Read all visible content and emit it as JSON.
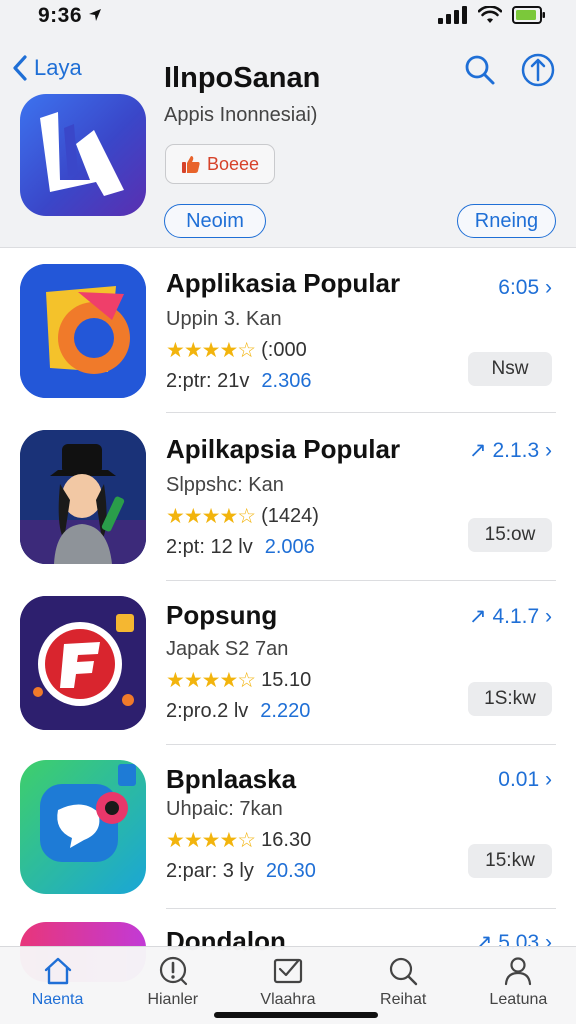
{
  "status": {
    "time": "9:36"
  },
  "header": {
    "back_label": "Laya",
    "title": "IlnpoSanan",
    "subtitle": "Appis Inonnesiai)",
    "badge_label": "Boeee",
    "pill_left": "Neoim",
    "pill_right": "Rneing"
  },
  "apps": [
    {
      "title": "Applikasia Popular",
      "subtitle": "Uppin 3. Kan",
      "rating_text": "(:000",
      "meta_left": "2:ptr: 21v",
      "meta_right": "2.306",
      "version": "6:05",
      "button": "Nsw"
    },
    {
      "title": "Apilkapsia Popular",
      "subtitle": "Slppshc: Kan",
      "rating_text": "(1424)",
      "meta_left": "2:pt: 12 lv",
      "meta_right": "2.006",
      "version": "2.1.3",
      "button": "15:ow"
    },
    {
      "title": "Popsung",
      "subtitle": "Japak S2 7an",
      "rating_text": "15.10",
      "meta_left": "2:pro.2 lv",
      "meta_right": "2.220",
      "version": "4.1.7",
      "button": "1S:kw"
    },
    {
      "title": "Bpnlaaska",
      "subtitle": "Uhpaic: 7kan",
      "rating_text": "16.30",
      "meta_left": "2:par: 3 ly",
      "meta_right": "20.30",
      "version": "0.01",
      "button": "15:kw"
    },
    {
      "title": "Dondalon",
      "version": "5.03"
    }
  ],
  "tabs": [
    {
      "label": "Naenta",
      "icon": "home-icon",
      "active": true
    },
    {
      "label": "Hianler",
      "icon": "alert-icon",
      "active": false
    },
    {
      "label": "Vlaahra",
      "icon": "inbox-icon",
      "active": false
    },
    {
      "label": "Reihat",
      "icon": "search-icon",
      "active": false
    },
    {
      "label": "Leatuna",
      "icon": "person-icon",
      "active": false
    }
  ],
  "colors": {
    "accent": "#1f6fd6",
    "star": "#f2b40d",
    "badge_red": "#d6422a"
  }
}
